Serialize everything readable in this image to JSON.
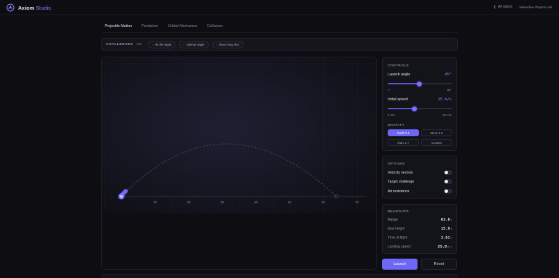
{
  "app": {
    "brand_name": "Axiom",
    "brand_accent": "Studio",
    "all_topics": "All topics",
    "lab_name": "Interactive Physics Lab"
  },
  "tabs": [
    {
      "label": "Projectile Motion",
      "active": true
    },
    {
      "label": "Pendulum",
      "active": false
    },
    {
      "label": "Orbital Mechanics",
      "active": false
    },
    {
      "label": "Collisions",
      "active": false
    }
  ],
  "challenges": {
    "label": "CHALLENGES",
    "count": "0/3",
    "items": [
      {
        "label": "Hit the target"
      },
      {
        "label": "Optimal angle"
      },
      {
        "label": "Moon long shot"
      }
    ]
  },
  "canvas": {
    "x_ticks": [
      "10",
      "20",
      "30",
      "40",
      "50",
      "60",
      "70"
    ]
  },
  "controls": {
    "title": "CONTROLS",
    "launch_angle_label": "Launch angle",
    "launch_angle_value": "45°",
    "launch_angle_fraction": 0.4886,
    "angle_min": "1°",
    "angle_max": "89°",
    "speed_label": "Initial speed",
    "speed_value": "25 m/s",
    "speed_fraction": 0.4118,
    "speed_min": "8 m/s",
    "speed_max": "50 m/s",
    "gravity_title": "GRAVITY",
    "gravity_options": [
      {
        "label": "Earth 9.8",
        "active": true
      },
      {
        "label": "Moon 1.6",
        "active": false
      },
      {
        "label": "Mars 3.7",
        "active": false
      },
      {
        "label": "Custom",
        "active": false
      }
    ]
  },
  "options": {
    "title": "OPTIONS",
    "items": [
      {
        "label": "Velocity vectors",
        "on": false
      },
      {
        "label": "Target challenge",
        "on": false
      },
      {
        "label": "Air resistance",
        "on": false
      }
    ]
  },
  "readouts": {
    "title": "READOUTS",
    "rows": [
      {
        "label": "Range",
        "value": "63.8",
        "unit": "m"
      },
      {
        "label": "Max height",
        "value": "15.9",
        "unit": "m"
      },
      {
        "label": "Time of flight",
        "value": "3.61",
        "unit": "s"
      },
      {
        "label": "Landing speed",
        "value": "25.0",
        "unit": "m/s"
      }
    ]
  },
  "actions": {
    "launch": "Launch",
    "reset": "Reset"
  },
  "colors": {
    "accent": "#7c74ff",
    "background": "#0d0d12",
    "panel": "#13131a"
  }
}
